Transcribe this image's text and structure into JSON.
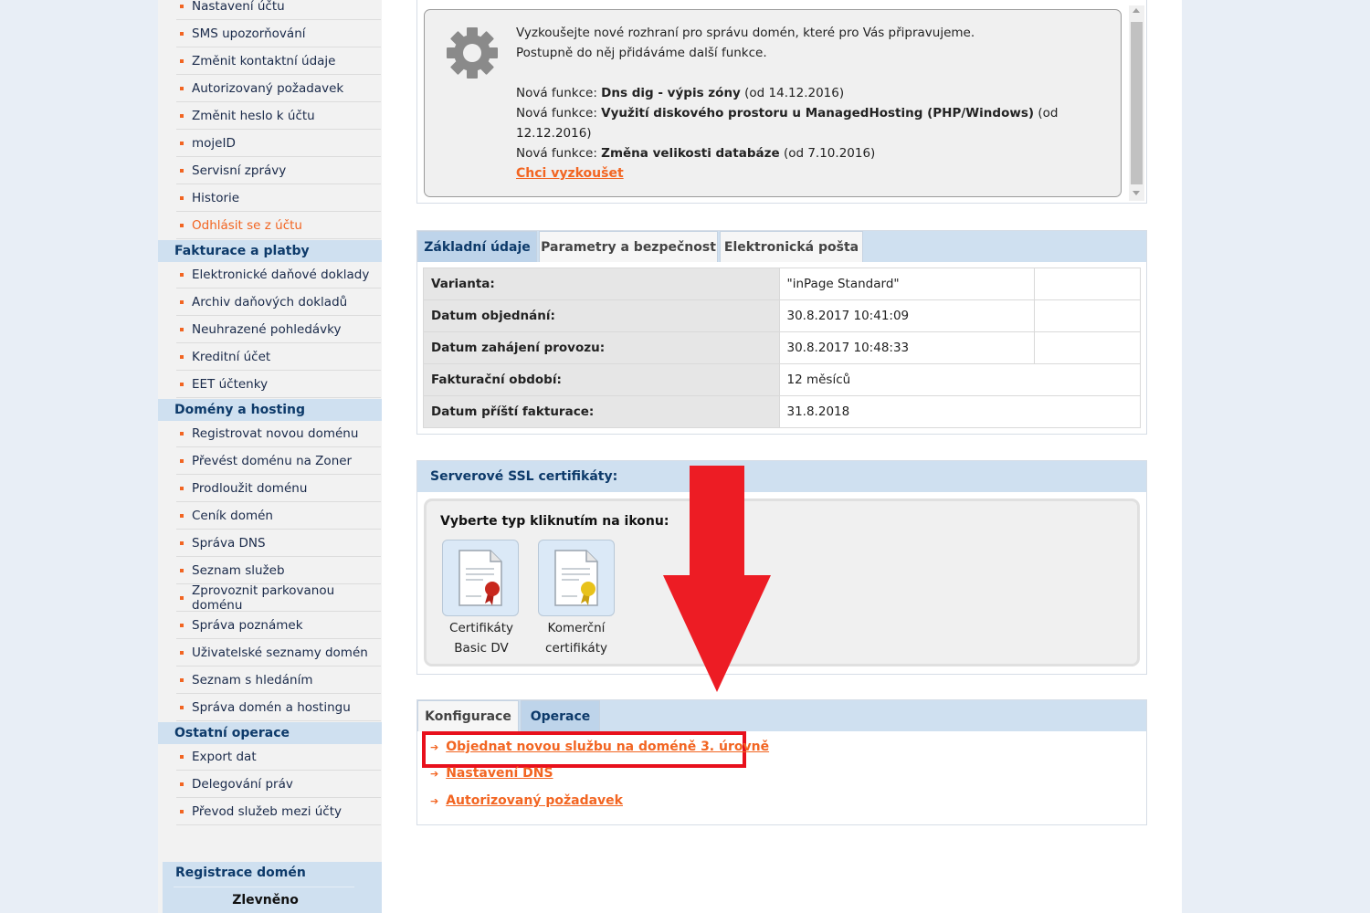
{
  "sidebar": {
    "top_items": [
      {
        "label": "Nastavení účtu"
      },
      {
        "label": "SMS upozorňování"
      },
      {
        "label": "Změnit kontaktní údaje"
      },
      {
        "label": "Autorizovaný požadavek"
      },
      {
        "label": "Změnit heslo k účtu"
      },
      {
        "label": "mojeID"
      },
      {
        "label": "Servisní zprávy"
      },
      {
        "label": "Historie"
      },
      {
        "label": "Odhlásit se z účtu"
      }
    ],
    "billing": {
      "heading": "Fakturace a platby",
      "items": [
        {
          "label": "Elektronické daňové doklady"
        },
        {
          "label": "Archiv daňových dokladů"
        },
        {
          "label": "Neuhrazené pohledávky"
        },
        {
          "label": "Kreditní účet"
        },
        {
          "label": "EET účtenky"
        }
      ]
    },
    "domains": {
      "heading": "Domény a hosting",
      "items": [
        {
          "label": "Registrovat novou doménu"
        },
        {
          "label": "Převést doménu na Zoner"
        },
        {
          "label": "Prodloužit doménu"
        },
        {
          "label": "Ceník domén"
        },
        {
          "label": "Správa DNS"
        },
        {
          "label": "Seznam služeb"
        },
        {
          "label": "Zprovoznit parkovanou doménu"
        },
        {
          "label": "Správa poznámek"
        },
        {
          "label": "Uživatelské seznamy domén"
        },
        {
          "label": "Seznam s hledáním"
        },
        {
          "label": "Správa domén a hostingu"
        }
      ]
    },
    "other": {
      "heading": "Ostatní operace",
      "items": [
        {
          "label": "Export dat"
        },
        {
          "label": "Delegování práv"
        },
        {
          "label": "Převod služeb mezi účty"
        }
      ]
    },
    "promo": {
      "title": "Registrace domén",
      "subtitle": "Zlevněno"
    }
  },
  "notice": {
    "line1": "Vyzkoušejte nové rozhraní pro správu domén, které pro Vás připravujeme.",
    "line2": "Postupně do něj přidáváme další funkce.",
    "features": [
      {
        "prefix": "Nová funkce:",
        "name": "Dns dig - výpis zóny",
        "date": "(od 14.12.2016)"
      },
      {
        "prefix": "Nová funkce:",
        "name": "Využití diskového prostoru u ManagedHosting (PHP/Windows)",
        "date": "(od 12.12.2016)"
      },
      {
        "prefix": "Nová funkce:",
        "name": "Změna velikosti databáze",
        "date": "(od 7.10.2016)"
      }
    ],
    "link": "Chci vyzkoušet"
  },
  "info_tabs": [
    {
      "label": "Základní údaje",
      "active": true
    },
    {
      "label": "Parametry a bezpečnost",
      "active": false
    },
    {
      "label": "Elektronická pošta",
      "active": false
    }
  ],
  "info_rows": [
    {
      "label": "Varianta:",
      "value": "\"inPage Standard\""
    },
    {
      "label": "Datum objednání:",
      "value": "30.8.2017 10:41:09"
    },
    {
      "label": "Datum zahájení provozu:",
      "value": "30.8.2017 10:48:33"
    },
    {
      "label": "Fakturační období:",
      "value": "12 měsíců"
    },
    {
      "label": "Datum příští fakturace:",
      "value": "31.8.2018"
    }
  ],
  "ssl": {
    "title": "Serverové SSL certifikáty:",
    "prompt": "Vyberte typ kliknutím na ikonu:",
    "certs": [
      {
        "line1": "Certifikáty",
        "line2": "Basic DV",
        "seal_color": "#c8281e"
      },
      {
        "line1": "Komerční",
        "line2": "certifikáty",
        "seal_color": "#e8c21a"
      }
    ]
  },
  "ops_tabs": [
    {
      "label": "Konfigurace",
      "active": false
    },
    {
      "label": "Operace",
      "active": true
    }
  ],
  "operations": [
    {
      "label": "Objednat novou službu na doméně 3. úrovně",
      "highlighted": true
    },
    {
      "label": "Nastavení DNS",
      "highlighted": false
    },
    {
      "label": "Autorizovaný požadavek",
      "highlighted": false
    }
  ],
  "colors": {
    "accent_orange": "#f26522",
    "nav_blue": "#0d3a6a",
    "header_bar": "#cfe0f0",
    "annotation_red": "#e8101c"
  }
}
